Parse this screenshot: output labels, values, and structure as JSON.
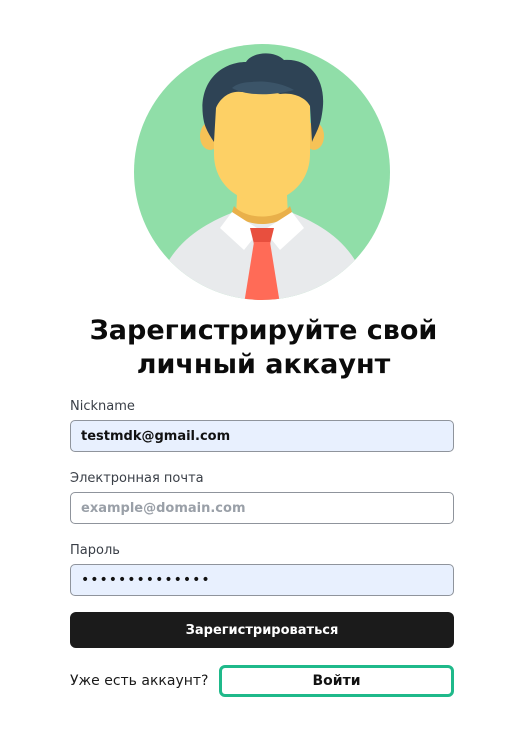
{
  "avatar": {
    "icon": "user-avatar-icon",
    "background_color": "#90dea8",
    "shirt_color": "#e8eaec",
    "tie_color": "#ff6b57",
    "skin_color": "#fdd065",
    "hair_color": "#2e4355"
  },
  "heading": {
    "line1": "Зарегистрируйте свой",
    "line2": "личный аккаунт"
  },
  "form": {
    "nickname": {
      "label": "Nickname",
      "value": "testmdk@gmail.com",
      "placeholder": ""
    },
    "email": {
      "label": "Электронная почта",
      "value": "",
      "placeholder": "example@domain.com"
    },
    "password": {
      "label": "Пароль",
      "value": "••••••••••••••"
    }
  },
  "register_button": {
    "label": "Зарегистрироваться",
    "color": "#1b1b1b"
  },
  "login": {
    "prompt": "Уже есть аккаунт?",
    "button_label": "Войти",
    "border_color": "#1fb98a"
  }
}
